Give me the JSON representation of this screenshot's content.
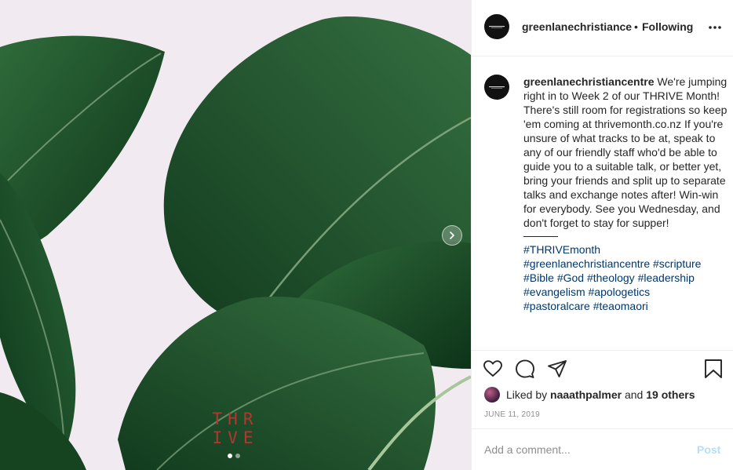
{
  "media": {
    "logo_line1": "THR",
    "logo_line2": "IVE",
    "slide_count": 2,
    "active_slide": 1,
    "icons": {
      "next": "chevron-right-icon"
    }
  },
  "post": {
    "username": "greenlanechristiance",
    "separator": "•",
    "follow_state": "Following",
    "caption_username": "greenlanechristiancentre",
    "caption_text": " We're jumping right in to Week 2 of our THRIVE Month! There's still room for registrations so keep 'em coming at thrivemonth.co.nz If you're unsure of what tracks to be at, speak to any of our friendly staff who'd be able to guide you to a suitable talk, or better yet, bring your friends and split up to separate talks and exchange notes after! Win-win for everybody. See you Wednesday, and don't forget to stay for supper!",
    "hashtags": [
      "#THRIVEmonth",
      "#greenlanechristiancentre",
      "#scripture",
      "#Bible",
      "#God",
      "#theology",
      "#leadership",
      "#evangelism",
      "#apologetics",
      "#pastoralcare",
      "#teaomaori"
    ],
    "likes": {
      "prefix": "Liked by",
      "user": "naaathpalmer",
      "conj": "and",
      "others": "19 others"
    },
    "date": "JUNE 11, 2019",
    "comment_placeholder": "Add a comment...",
    "post_label": "Post",
    "icons": {
      "more": "more-options-icon",
      "like": "heart-icon",
      "comment": "comment-icon",
      "share": "share-icon",
      "save": "bookmark-icon"
    },
    "colors": {
      "hashtag": "#00376b",
      "post_disabled": "#b2dffc",
      "muted": "#8e8e8e"
    }
  }
}
